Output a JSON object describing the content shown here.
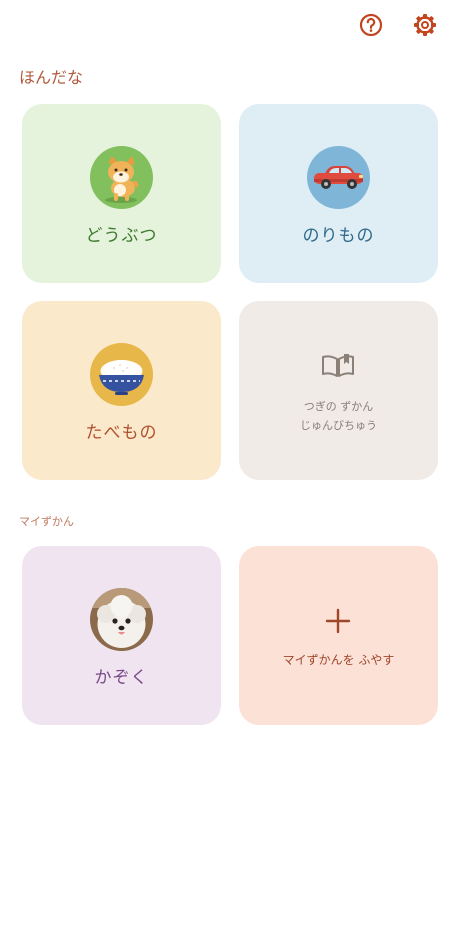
{
  "header": {
    "help_icon": "help-circle-icon",
    "settings_icon": "gear-icon"
  },
  "shelf": {
    "title": "ほんだな",
    "books": [
      {
        "label": "どうぶつ",
        "icon": "shiba-dog-icon",
        "color": "#e5f3dc"
      },
      {
        "label": "のりもの",
        "icon": "red-car-icon",
        "color": "#dfedf5"
      },
      {
        "label": "たべもの",
        "icon": "rice-bowl-icon",
        "color": "#fbe9cb"
      }
    ],
    "next_book": {
      "icon": "open-book-icon",
      "line1": "つぎの ずかん",
      "line2": "じゅんびちゅう"
    }
  },
  "my_books": {
    "title": "マイずかん",
    "items": [
      {
        "label": "かぞく",
        "icon": "white-poodle-photo",
        "color": "#f0e4f0"
      }
    ],
    "add": {
      "icon": "plus-icon",
      "label": "マイずかんを ふやす",
      "color": "#fbe1d6"
    }
  },
  "colors": {
    "accent": "#b05a3c",
    "icon": "#c2451e"
  }
}
